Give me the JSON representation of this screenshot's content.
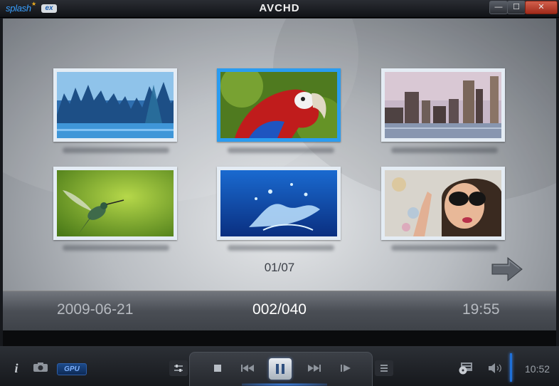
{
  "titlebar": {
    "logo_text": "splash",
    "logo_badge": "ex",
    "title": "AVCHD",
    "minimize_label": "—",
    "maximize_label": "☐",
    "close_label": "✕"
  },
  "gallery": {
    "thumbnails": [
      {
        "subject": "blue-forest-lake",
        "selected": false
      },
      {
        "subject": "red-parrot",
        "selected": true
      },
      {
        "subject": "city-skyline",
        "selected": false
      },
      {
        "subject": "hummingbird",
        "selected": false
      },
      {
        "subject": "water-splash",
        "selected": false
      },
      {
        "subject": "woman-sunglasses",
        "selected": false
      }
    ],
    "page_indicator": "01/07",
    "next_icon": "arrow-right-icon"
  },
  "info_bar": {
    "date": "2009-06-21",
    "file_counter": "002/040",
    "time": "19:55"
  },
  "controls": {
    "gpu_label": "GPU",
    "clock": "10:52",
    "icons": [
      "info-icon",
      "camera-icon",
      "equalizer-icon",
      "stop-icon",
      "previous-icon",
      "pause-icon",
      "next-icon",
      "step-icon",
      "playlist-icon",
      "disc-menu-icon",
      "volume-icon"
    ],
    "accent_color": "#2a9cf0"
  }
}
